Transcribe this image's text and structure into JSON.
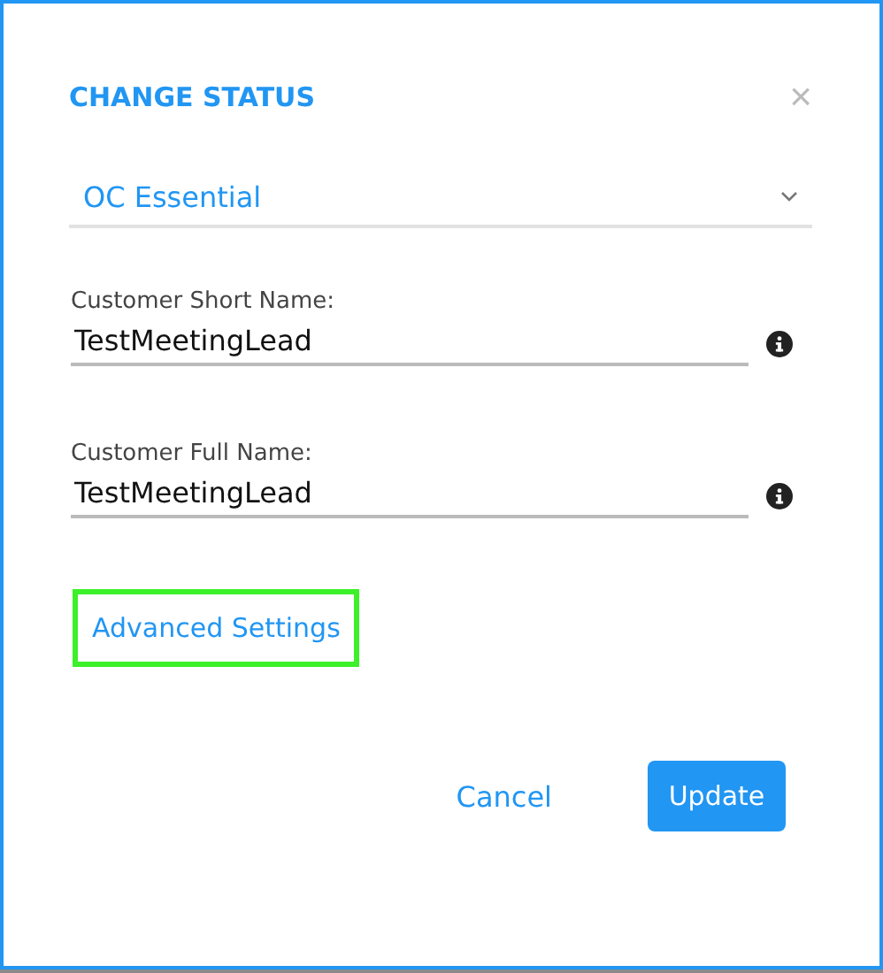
{
  "dialog": {
    "title": "CHANGE STATUS",
    "close": "×"
  },
  "status_select": {
    "value": "OC Essential"
  },
  "fields": [
    {
      "label": "Customer Short Name:",
      "value": "TestMeetingLead"
    },
    {
      "label": "Customer Full Name:",
      "value": "TestMeetingLead"
    }
  ],
  "advanced_link": {
    "label": "Advanced Settings",
    "highlighted": true
  },
  "buttons": [
    {
      "label": "Cancel",
      "kind": "link"
    },
    {
      "label": "Update",
      "kind": "primary"
    }
  ]
}
